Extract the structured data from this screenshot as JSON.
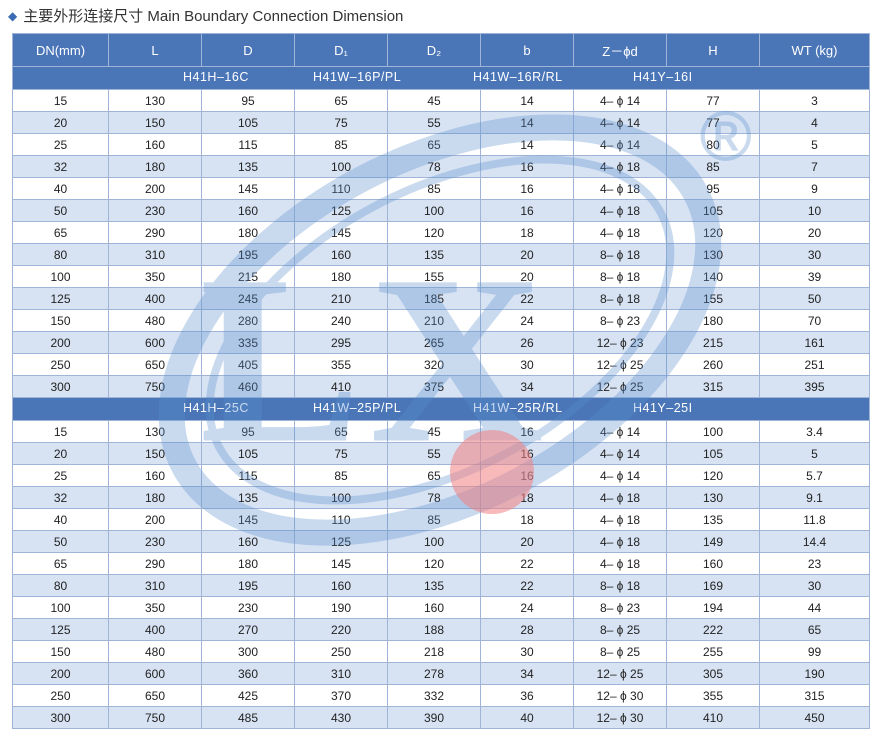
{
  "title": "主要外形连接尺寸 Main Boundary Connection Dimension",
  "columns": [
    "DN(mm)",
    "L",
    "D",
    "D₁",
    "D₂",
    "b",
    "Z－ϕd",
    "H",
    "WT (kg)"
  ],
  "sections": [
    {
      "labels": [
        "H41H–16C",
        "H41W–16P/PL",
        "H41W–16R/RL",
        "H41Y–16I"
      ],
      "rows": [
        [
          "15",
          "130",
          "95",
          "65",
          "45",
          "14",
          "4– ϕ 14",
          "77",
          "3"
        ],
        [
          "20",
          "150",
          "105",
          "75",
          "55",
          "14",
          "4– ϕ 14",
          "77",
          "4"
        ],
        [
          "25",
          "160",
          "115",
          "85",
          "65",
          "14",
          "4– ϕ 14",
          "80",
          "5"
        ],
        [
          "32",
          "180",
          "135",
          "100",
          "78",
          "16",
          "4– ϕ 18",
          "85",
          "7"
        ],
        [
          "40",
          "200",
          "145",
          "110",
          "85",
          "16",
          "4– ϕ 18",
          "95",
          "9"
        ],
        [
          "50",
          "230",
          "160",
          "125",
          "100",
          "16",
          "4– ϕ 18",
          "105",
          "10"
        ],
        [
          "65",
          "290",
          "180",
          "145",
          "120",
          "18",
          "4– ϕ 18",
          "120",
          "20"
        ],
        [
          "80",
          "310",
          "195",
          "160",
          "135",
          "20",
          "8– ϕ 18",
          "130",
          "30"
        ],
        [
          "100",
          "350",
          "215",
          "180",
          "155",
          "20",
          "8– ϕ 18",
          "140",
          "39"
        ],
        [
          "125",
          "400",
          "245",
          "210",
          "185",
          "22",
          "8– ϕ 18",
          "155",
          "50"
        ],
        [
          "150",
          "480",
          "280",
          "240",
          "210",
          "24",
          "8– ϕ 23",
          "180",
          "70"
        ],
        [
          "200",
          "600",
          "335",
          "295",
          "265",
          "26",
          "12– ϕ 23",
          "215",
          "161"
        ],
        [
          "250",
          "650",
          "405",
          "355",
          "320",
          "30",
          "12– ϕ 25",
          "260",
          "251"
        ],
        [
          "300",
          "750",
          "460",
          "410",
          "375",
          "34",
          "12– ϕ 25",
          "315",
          "395"
        ]
      ]
    },
    {
      "labels": [
        "H41H–25C",
        "H41W–25P/PL",
        "H41W–25R/RL",
        "H41Y–25I"
      ],
      "rows": [
        [
          "15",
          "130",
          "95",
          "65",
          "45",
          "16",
          "4– ϕ 14",
          "100",
          "3.4"
        ],
        [
          "20",
          "150",
          "105",
          "75",
          "55",
          "16",
          "4– ϕ 14",
          "105",
          "5"
        ],
        [
          "25",
          "160",
          "115",
          "85",
          "65",
          "16",
          "4– ϕ 14",
          "120",
          "5.7"
        ],
        [
          "32",
          "180",
          "135",
          "100",
          "78",
          "18",
          "4– ϕ 18",
          "130",
          "9.1"
        ],
        [
          "40",
          "200",
          "145",
          "110",
          "85",
          "18",
          "4– ϕ 18",
          "135",
          "11.8"
        ],
        [
          "50",
          "230",
          "160",
          "125",
          "100",
          "20",
          "4– ϕ 18",
          "149",
          "14.4"
        ],
        [
          "65",
          "290",
          "180",
          "145",
          "120",
          "22",
          "4– ϕ 18",
          "160",
          "23"
        ],
        [
          "80",
          "310",
          "195",
          "160",
          "135",
          "22",
          "8– ϕ 18",
          "169",
          "30"
        ],
        [
          "100",
          "350",
          "230",
          "190",
          "160",
          "24",
          "8– ϕ 23",
          "194",
          "44"
        ],
        [
          "125",
          "400",
          "270",
          "220",
          "188",
          "28",
          "8– ϕ 25",
          "222",
          "65"
        ],
        [
          "150",
          "480",
          "300",
          "250",
          "218",
          "30",
          "8– ϕ 25",
          "255",
          "99"
        ],
        [
          "200",
          "600",
          "360",
          "310",
          "278",
          "34",
          "12– ϕ 25",
          "305",
          "190"
        ],
        [
          "250",
          "650",
          "425",
          "370",
          "332",
          "36",
          "12– ϕ 30",
          "355",
          "315"
        ],
        [
          "300",
          "750",
          "485",
          "430",
          "390",
          "40",
          "12– ϕ 30",
          "410",
          "450"
        ]
      ]
    }
  ],
  "watermark": {
    "letters": "LX",
    "mark": "®",
    "color": "#5b8fd0"
  }
}
